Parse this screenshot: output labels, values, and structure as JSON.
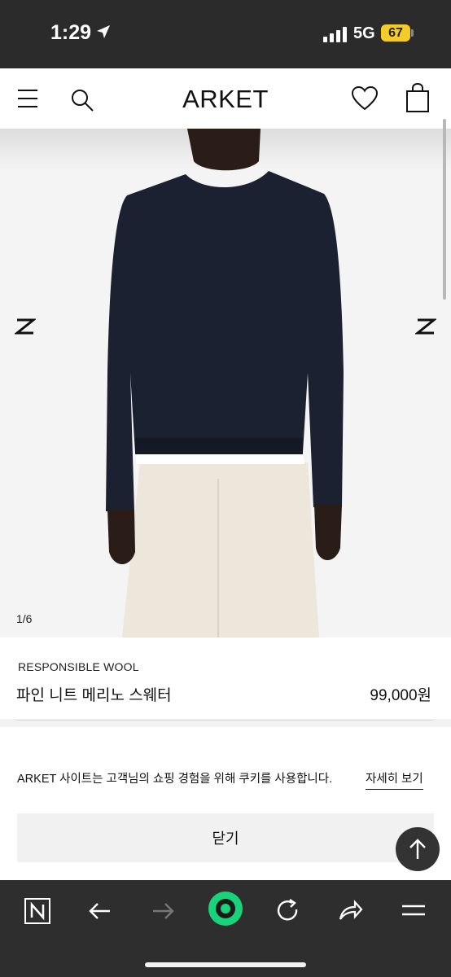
{
  "status_bar": {
    "time": "1:29",
    "network": "5G",
    "battery": "67"
  },
  "header": {
    "logo": "ARKET",
    "icons": [
      "menu-icon",
      "search-icon",
      "heart-icon",
      "bag-icon"
    ]
  },
  "gallery": {
    "counter": "1/6",
    "prev_arrow": "Z",
    "next_arrow": "Z",
    "current_index": 1,
    "total": 6
  },
  "product": {
    "tag": "RESPONSIBLE WOOL",
    "name": "파인 니트 메리노 스웨터",
    "price": "99,000원"
  },
  "cookie_banner": {
    "text": "ARKET 사이트는 고객님의 쇼핑 경험을 위해 쿠키를 사용합니다.",
    "link": "자세히 보기",
    "close_label": "닫기"
  },
  "browser_toolbar": {
    "icons": [
      "naver-icon",
      "back-arrow-icon",
      "forward-arrow-icon",
      "green-dot-icon",
      "reload-icon",
      "share-icon",
      "menu-icon"
    ],
    "accent": "#19d37a"
  }
}
